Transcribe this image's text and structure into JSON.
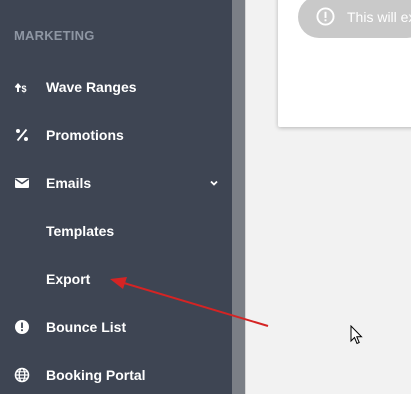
{
  "sidebar": {
    "section_title": "MARKETING",
    "items": [
      {
        "label": "Wave Ranges",
        "icon": "wave-ranges-icon"
      },
      {
        "label": "Promotions",
        "icon": "percent-icon"
      },
      {
        "label": "Emails",
        "icon": "mail-icon",
        "expanded": true
      },
      {
        "label": "Templates"
      },
      {
        "label": "Export"
      },
      {
        "label": "Bounce List",
        "icon": "alert-circle-icon"
      },
      {
        "label": "Booking Portal",
        "icon": "globe-icon"
      }
    ]
  },
  "dialog": {
    "alert_text": "This will ex"
  },
  "colors": {
    "sidebar_bg": "#3e4553",
    "section_title": "#8e96a3",
    "annotation_arrow": "#d42424"
  },
  "annotation": {
    "type": "arrow",
    "points_to": "Export"
  }
}
